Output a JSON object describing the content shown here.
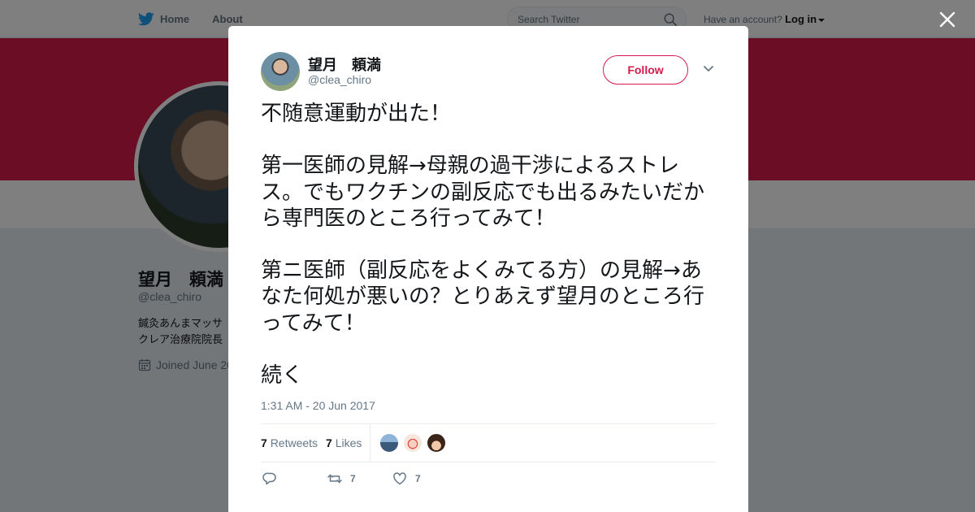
{
  "topbar": {
    "home_label": "Home",
    "about_label": "About",
    "search_placeholder": "Search Twitter",
    "account_prompt": "Have an account?",
    "login_label": "Log in"
  },
  "profile": {
    "name": "望月　頼満",
    "handle": "@clea_chiro",
    "bio": "鍼灸あんまマッサ\nクレア治療院院長",
    "joined": "Joined June 20"
  },
  "colors": {
    "brand": "#d61a4b",
    "twitter_blue": "#1da1f2",
    "text": "#14171a",
    "muted": "#657786"
  },
  "tweet": {
    "author_name": "望月　頼満",
    "author_handle": "@clea_chiro",
    "follow_label": "Follow",
    "text": "不随意運動が出た！\n\n第一医師の見解→母親の過干渉によるストレス。でもワクチンの副反応でも出るみたいだから専門医のところ行ってみて！\n\n第ニ医師（副反応をよくみてる方）の見解→あなた何処が悪いの？とりあえず望月のところ行ってみて！\n\n続く",
    "timestamp": "1:31 AM - 20 Jun 2017",
    "retweets_count": "7",
    "retweets_label": "Retweets",
    "likes_count": "7",
    "likes_label": "Likes",
    "action_retweet_count": "7",
    "action_like_count": "7"
  },
  "icons": [
    "twitter-bird-icon",
    "search-icon",
    "close-icon",
    "chevron-down-icon",
    "calendar-icon",
    "reply-icon",
    "retweet-icon",
    "heart-icon"
  ]
}
